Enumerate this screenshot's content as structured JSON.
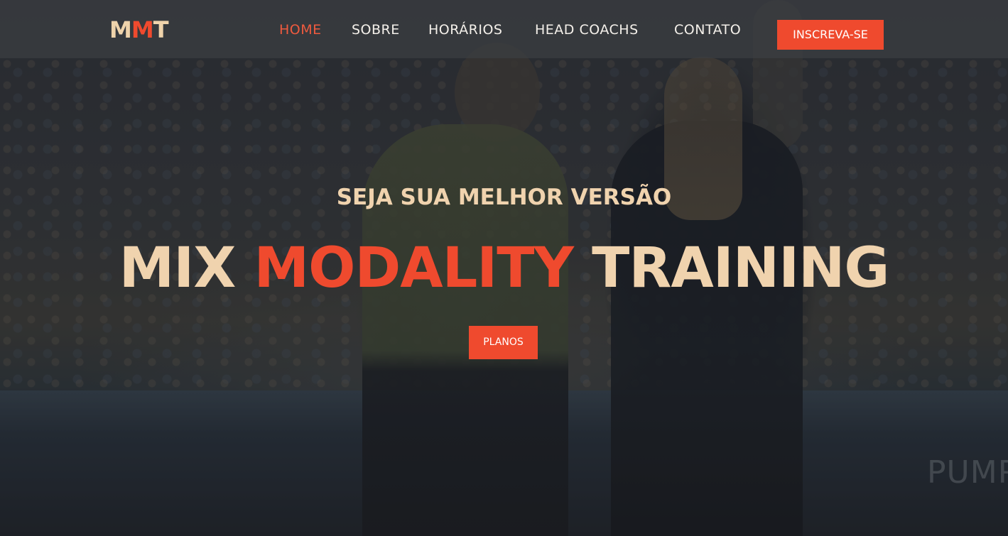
{
  "logo": {
    "part1": "M",
    "part2": "M",
    "part3": "T"
  },
  "nav": {
    "items": [
      {
        "label": "HOME",
        "active": true
      },
      {
        "label": "SOBRE",
        "active": false
      },
      {
        "label": "HORÁRIOS",
        "active": false
      },
      {
        "label": "HEAD COACHS",
        "active": false
      },
      {
        "label": "CONTATO",
        "active": false
      }
    ],
    "cta_label": "INSCREVA-SE"
  },
  "hero": {
    "tagline": "SEJA SUA MELHOR VERSÃO",
    "headline": {
      "word1": "MIX ",
      "word2": "MODALITY",
      "word3": " TRAINING"
    },
    "button_label": "PLANOS",
    "background_sign_text": "PUMP"
  },
  "colors": {
    "accent": "#ef4a2e",
    "cream": "#f0d3ae",
    "nav_text": "#f4f0ea"
  }
}
